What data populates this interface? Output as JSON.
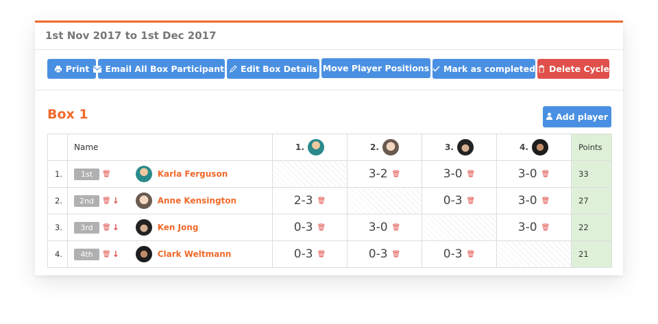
{
  "cycle_title": "1st Nov 2017 to 1st Dec 2017",
  "toolbar": {
    "print": "Print",
    "email": "Email All Box Participants",
    "edit": "Edit Box Details",
    "move": "Move Player Positions",
    "complete": "Mark as completed",
    "delete": "Delete Cycle"
  },
  "box": {
    "title": "Box 1",
    "add_player": "Add player",
    "headers": {
      "name": "Name",
      "points": "Points",
      "cols": [
        "1.",
        "2.",
        "3.",
        "4."
      ]
    },
    "rows": [
      {
        "num": "1.",
        "position": "1st",
        "name": "Karla Ferguson",
        "scores": [
          "",
          "3-2",
          "3-0",
          "3-0"
        ],
        "points": "33"
      },
      {
        "num": "2.",
        "position": "2nd",
        "name": "Anne Kensington",
        "scores": [
          "2-3",
          "",
          "0-3",
          "3-0"
        ],
        "points": "27"
      },
      {
        "num": "3.",
        "position": "3rd",
        "name": "Ken Jong",
        "scores": [
          "0-3",
          "3-0",
          "",
          "3-0"
        ],
        "points": "22"
      },
      {
        "num": "4.",
        "position": "4th",
        "name": "Clark Weltmann",
        "scores": [
          "0-3",
          "0-3",
          "0-3",
          ""
        ],
        "points": "21"
      }
    ]
  },
  "colors": {
    "accent": "#f0692b",
    "primary": "#4a90e2",
    "danger": "#e0504a",
    "points_bg": "#dff0d8"
  }
}
